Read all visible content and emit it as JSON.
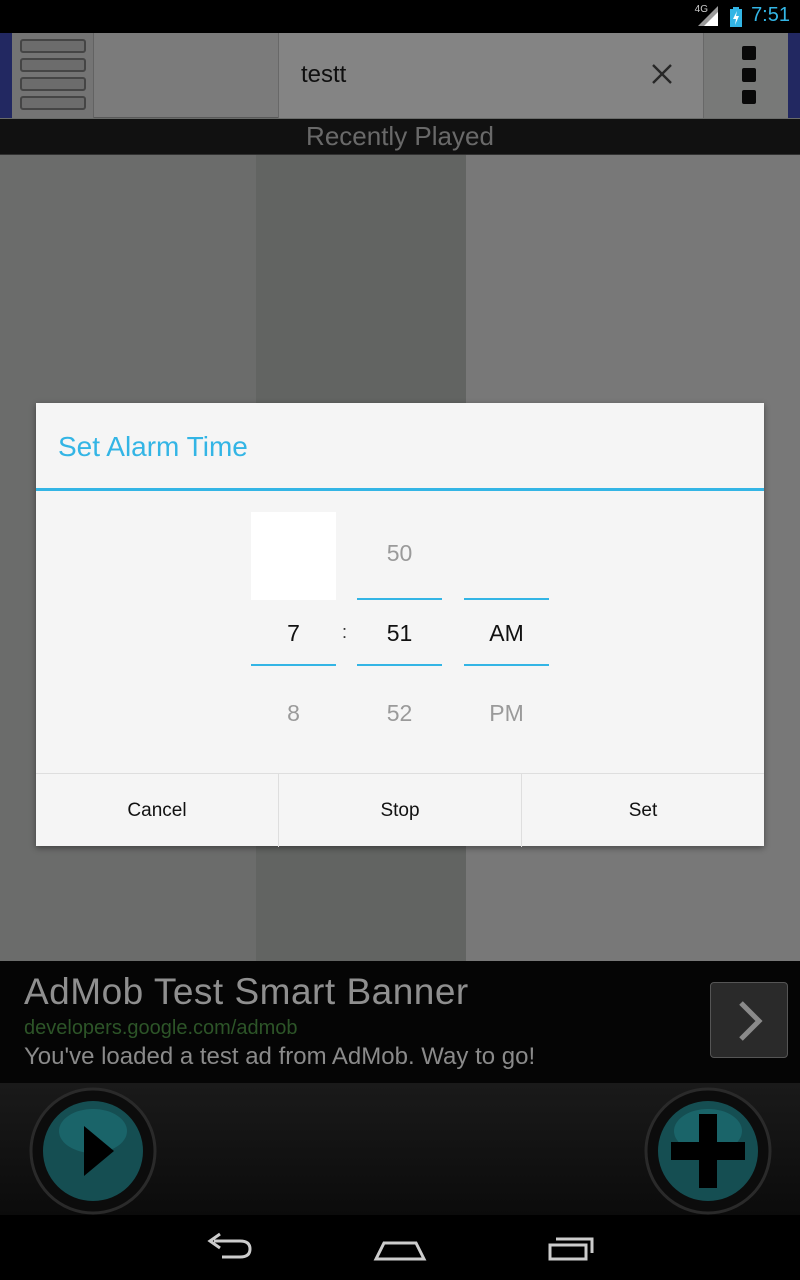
{
  "status_bar": {
    "time": "7:51",
    "network": "4G"
  },
  "toolbar": {
    "search_value": "testt"
  },
  "section": {
    "title": "Recently Played"
  },
  "dialog": {
    "title": "Set Alarm Time",
    "hour": {
      "prev": "",
      "current": "7",
      "next": "8"
    },
    "separator": ":",
    "minute": {
      "prev": "50",
      "current": "51",
      "next": "52"
    },
    "ampm": {
      "prev": "",
      "current": "AM",
      "next": "PM"
    },
    "buttons": {
      "cancel": "Cancel",
      "stop": "Stop",
      "set": "Set"
    }
  },
  "ad": {
    "title": "AdMob Test Smart Banner",
    "url": "developers.google.com/admob",
    "description": "You've loaded a test ad from AdMob. Way to go!"
  },
  "colors": {
    "accent": "#33b5e5",
    "ad_url": "#2d5528",
    "player_button": "#2aa6ad"
  },
  "icons": [
    "signal-icon",
    "battery-icon",
    "menu-icon",
    "clear-icon",
    "overflow-menu-icon",
    "chevron-right-icon",
    "play-icon",
    "add-icon",
    "back-icon",
    "home-icon",
    "recents-icon"
  ]
}
